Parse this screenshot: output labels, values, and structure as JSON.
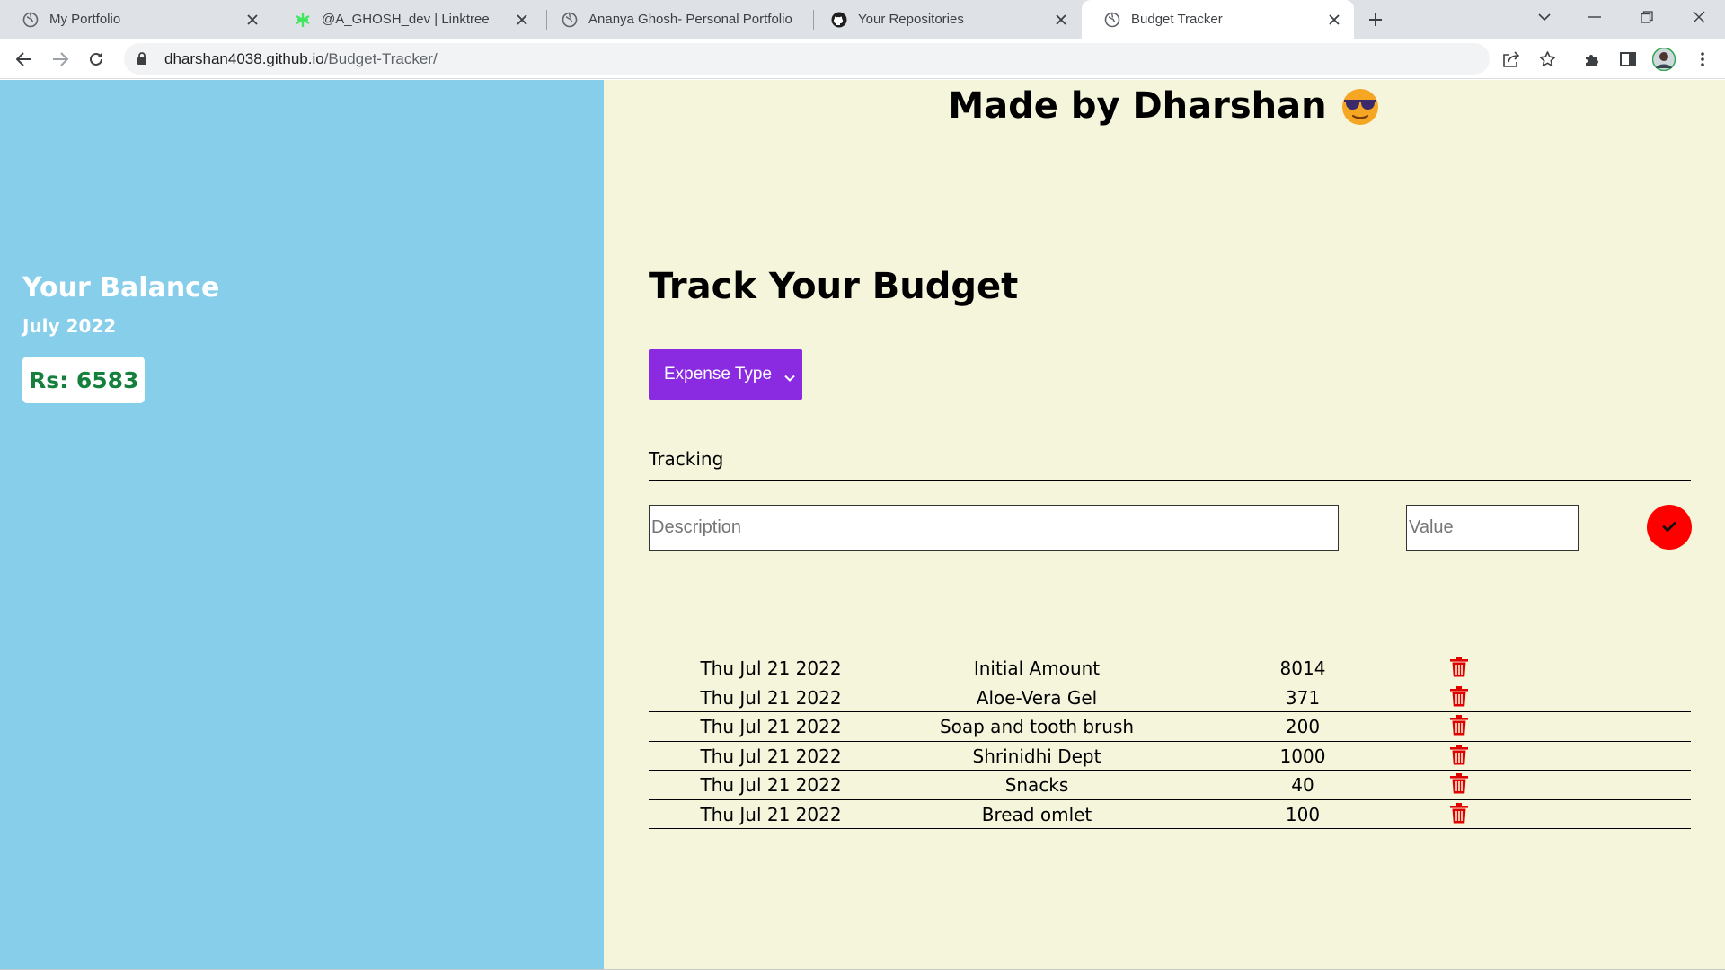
{
  "browser": {
    "tabs": [
      {
        "title": "My Portfolio",
        "favicon": "globe-icon",
        "active": false
      },
      {
        "title": "@A_GHOSH_dev | Linktree",
        "favicon": "linktree-icon",
        "active": false
      },
      {
        "title": "Ananya Ghosh- Personal Portfolio",
        "favicon": "globe-icon",
        "active": false
      },
      {
        "title": "Your Repositories",
        "favicon": "github-icon",
        "active": false
      },
      {
        "title": "Budget Tracker",
        "favicon": "globe-icon",
        "active": true
      }
    ],
    "url_host": "dharshan4038.github.io",
    "url_path": "/Budget-Tracker/"
  },
  "sidebar": {
    "title": "Your Balance",
    "month": "July 2022",
    "balance": "Rs: 6583"
  },
  "header": {
    "made_by": "Made by Dharshan"
  },
  "main": {
    "title": "Track Your Budget",
    "expense_type": "Expense Type",
    "tracking_label": "Tracking",
    "description_placeholder": "Description",
    "value_placeholder": "Value"
  },
  "transactions": [
    {
      "date": "Thu Jul 21 2022",
      "description": "Initial Amount",
      "value": "8014"
    },
    {
      "date": "Thu Jul 21 2022",
      "description": "Aloe-Vera Gel",
      "value": "371"
    },
    {
      "date": "Thu Jul 21 2022",
      "description": "Soap and tooth brush",
      "value": "200"
    },
    {
      "date": "Thu Jul 21 2022",
      "description": "Shrinidhi Dept",
      "value": "1000"
    },
    {
      "date": "Thu Jul 21 2022",
      "description": "Snacks",
      "value": "40"
    },
    {
      "date": "Thu Jul 21 2022",
      "description": "Bread omlet",
      "value": "100"
    }
  ],
  "colors": {
    "sidebar_bg": "#87ceeb",
    "main_bg": "#f5f5dc",
    "select_bg": "#8a2be2",
    "submit_bg": "#ff0000",
    "balance_text": "#15803d",
    "delete_icon": "#e00000"
  }
}
